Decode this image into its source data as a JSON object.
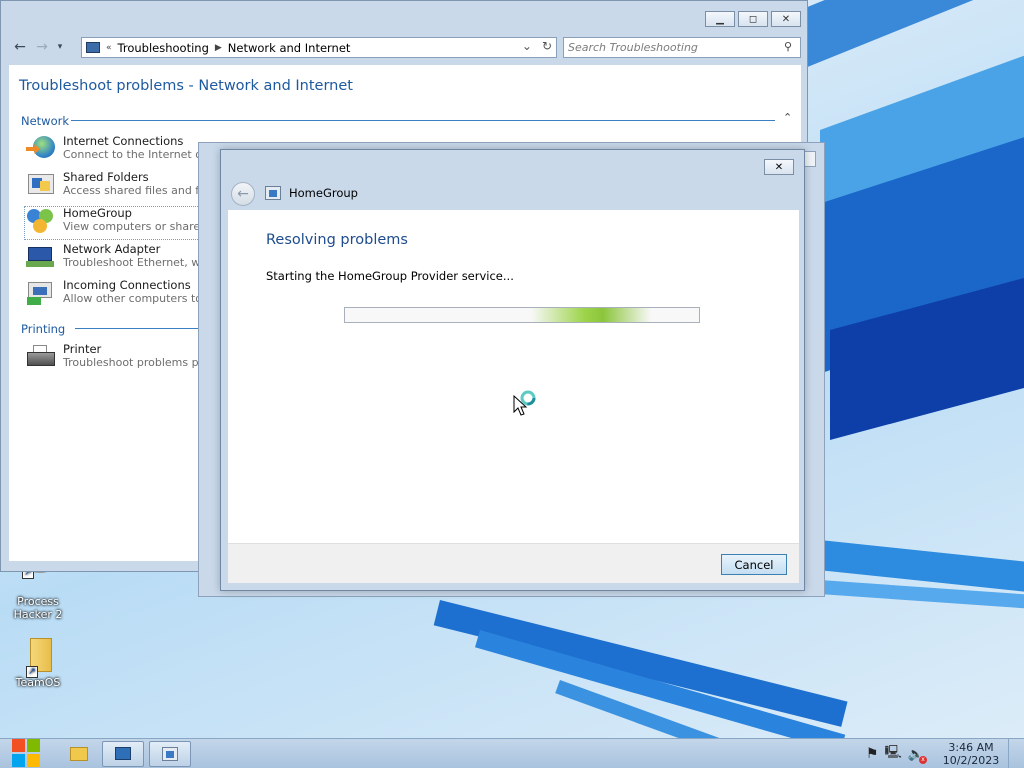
{
  "desktop": {
    "icons": [
      {
        "label": "Process Hacker 2",
        "icon": "process-hacker-icon"
      },
      {
        "label": "TeamOS",
        "icon": "folder-icon"
      }
    ]
  },
  "explorer": {
    "caption": {
      "minimize": "▭",
      "maximize": "▢",
      "close": "✕"
    },
    "breadcrumb": [
      "Troubleshooting",
      "Network and Internet"
    ],
    "search_placeholder": "Search Troubleshooting",
    "heading": "Troubleshoot problems - Network and Internet",
    "groups": [
      {
        "title": "Network",
        "items": [
          {
            "title": "Internet Connections",
            "desc": "Connect to the Internet or to a",
            "icon": "globe-icon"
          },
          {
            "title": "Shared Folders",
            "desc": "Access shared files and folders",
            "icon": "shared-folder-icon"
          },
          {
            "title": "HomeGroup",
            "desc": "View computers or shared files",
            "icon": "homegroup-icon"
          },
          {
            "title": "Network Adapter",
            "desc": "Troubleshoot Ethernet, wireles",
            "icon": "network-adapter-icon"
          },
          {
            "title": "Incoming Connections",
            "desc": "Allow other computers to comm",
            "icon": "incoming-connections-icon"
          }
        ]
      },
      {
        "title": "Printing",
        "items": [
          {
            "title": "Printer",
            "desc": "Troubleshoot problems preven",
            "icon": "printer-icon"
          }
        ]
      }
    ]
  },
  "dialog": {
    "title": "HomeGroup",
    "heading": "Resolving problems",
    "status": "Starting the HomeGroup Provider service...",
    "cancel_label": "Cancel",
    "close": "✕"
  },
  "taskbar": {
    "time": "3:46 AM",
    "date": "10/2/2023"
  }
}
